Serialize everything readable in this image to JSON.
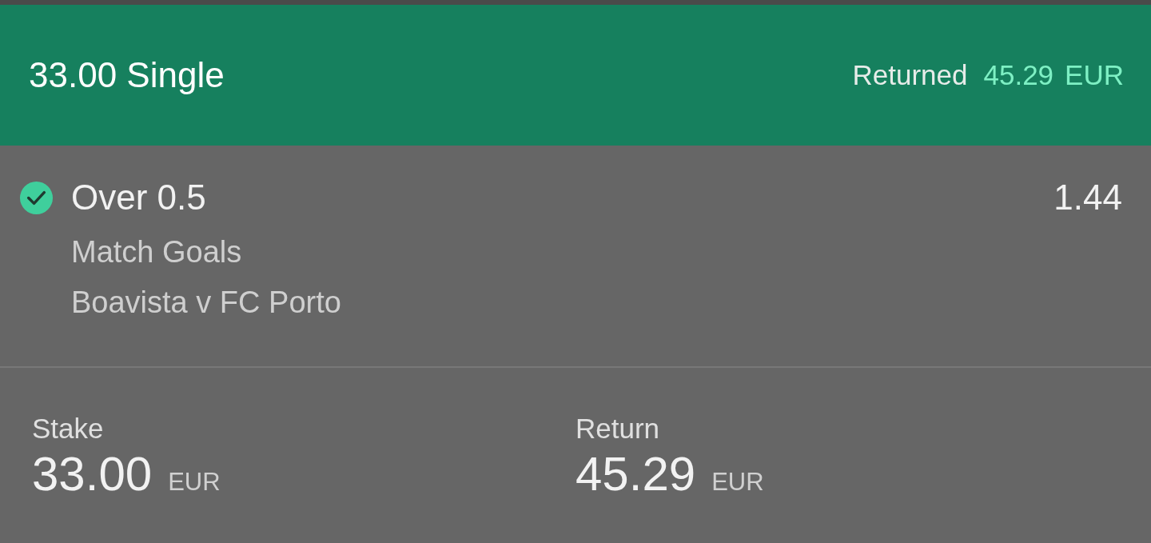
{
  "header": {
    "title": "33.00 Single",
    "status_label": "Returned",
    "amount": "45.29",
    "currency": "EUR"
  },
  "selection": {
    "won": true,
    "name": "Over 0.5",
    "odds": "1.44",
    "market": "Match Goals",
    "event": "Boavista v FC Porto"
  },
  "totals": [
    {
      "label": "Stake",
      "value": "33.00",
      "currency": "EUR"
    },
    {
      "label": "Return",
      "value": "45.29",
      "currency": "EUR"
    }
  ]
}
